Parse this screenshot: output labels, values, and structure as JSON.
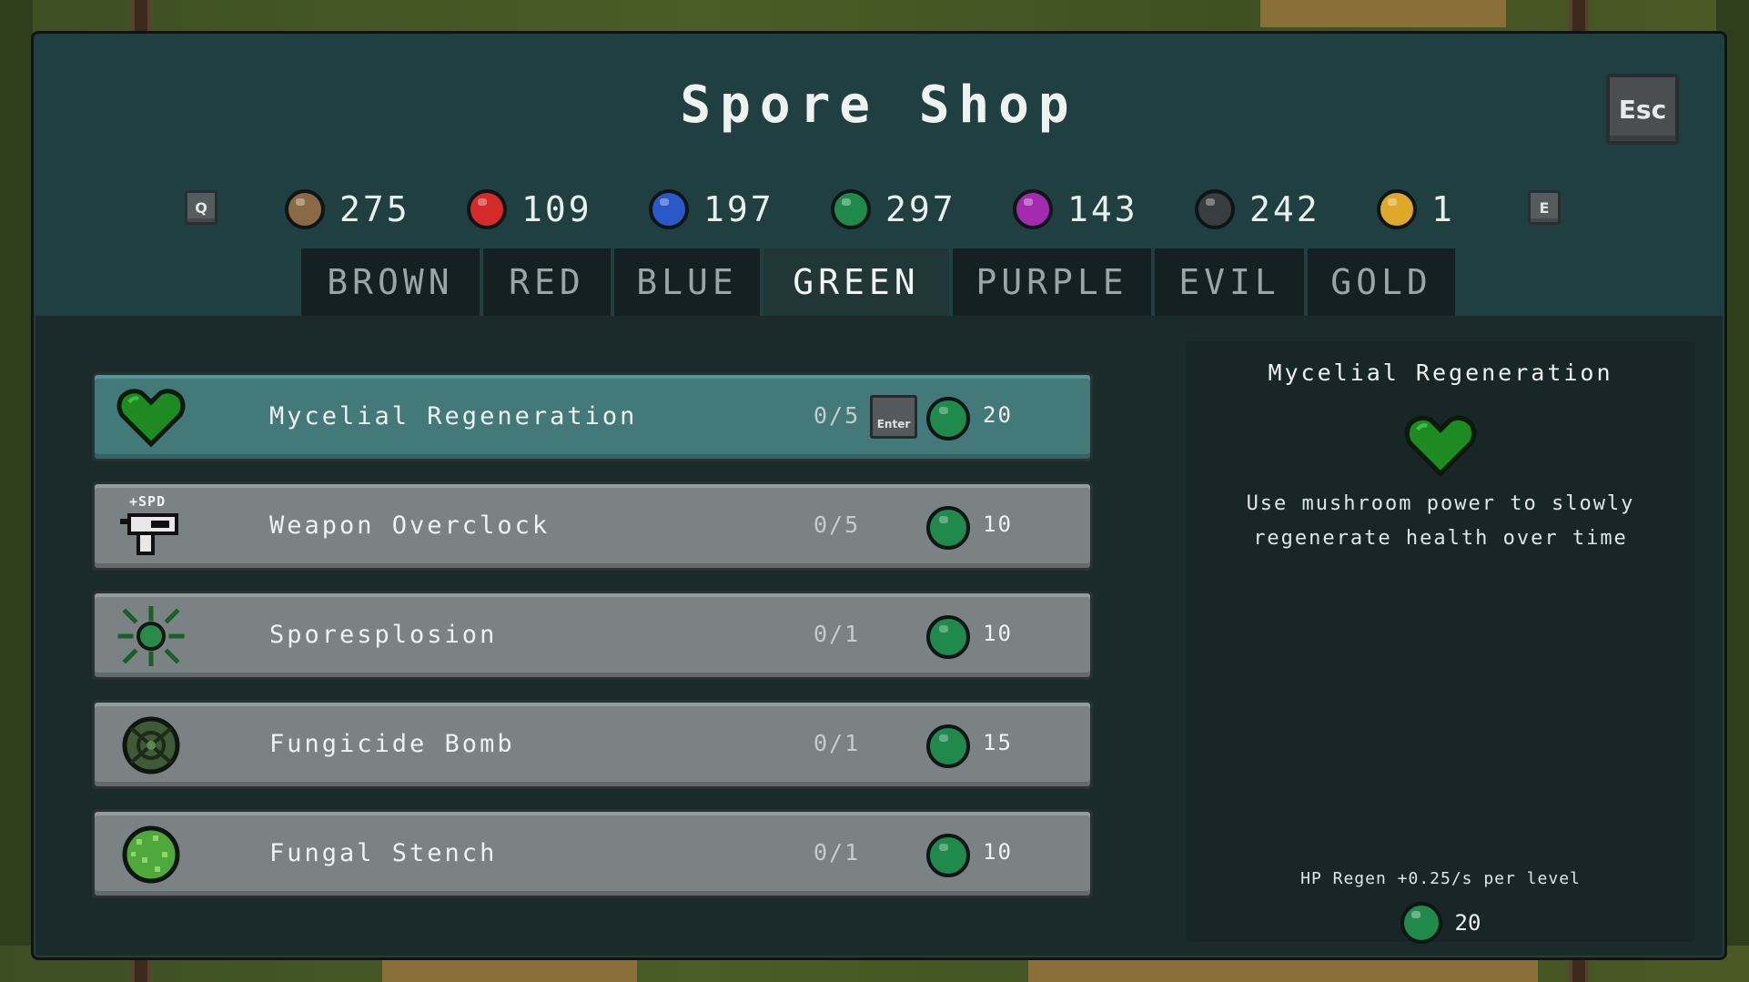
{
  "title": "Spore Shop",
  "esc_label": "Esc",
  "prev_key": "Q",
  "next_key": "E",
  "currencies": [
    {
      "name": "brown",
      "value": "275",
      "color": "#8a6a46"
    },
    {
      "name": "red",
      "value": "109",
      "color": "#d42a2a"
    },
    {
      "name": "blue",
      "value": "197",
      "color": "#2a58c8"
    },
    {
      "name": "green",
      "value": "297",
      "color": "#1f8a4c"
    },
    {
      "name": "purple",
      "value": "143",
      "color": "#a32bb0"
    },
    {
      "name": "evil",
      "value": "242",
      "color": "#3a3d3f"
    },
    {
      "name": "gold",
      "value": "1",
      "color": "#e0a82a"
    }
  ],
  "tabs": [
    {
      "label": "BROWN"
    },
    {
      "label": "RED"
    },
    {
      "label": "BLUE"
    },
    {
      "label": "GREEN",
      "active": true
    },
    {
      "label": "PURPLE"
    },
    {
      "label": "EVIL"
    },
    {
      "label": "GOLD"
    }
  ],
  "items": [
    {
      "name": "Mycelial Regeneration",
      "level": "0/5",
      "cost": "20",
      "icon": "heart-icon",
      "selected": true,
      "enter_label": "Enter"
    },
    {
      "name": "Weapon Overclock",
      "level": "0/5",
      "cost": "10",
      "icon": "gun-icon",
      "badge": "+SPD"
    },
    {
      "name": "Sporesplosion",
      "level": "0/1",
      "cost": "10",
      "icon": "spore-burst-icon"
    },
    {
      "name": "Fungicide Bomb",
      "level": "0/1",
      "cost": "15",
      "icon": "bomb-icon"
    },
    {
      "name": "Fungal Stench",
      "level": "0/1",
      "cost": "10",
      "icon": "stench-cloud-icon"
    }
  ],
  "detail": {
    "title": "Mycelial Regeneration",
    "description_line1": "Use mushroom power to slowly",
    "description_line2": "regenerate health over time",
    "stat": "HP Regen +0.25/s per level",
    "cost": "20"
  }
}
